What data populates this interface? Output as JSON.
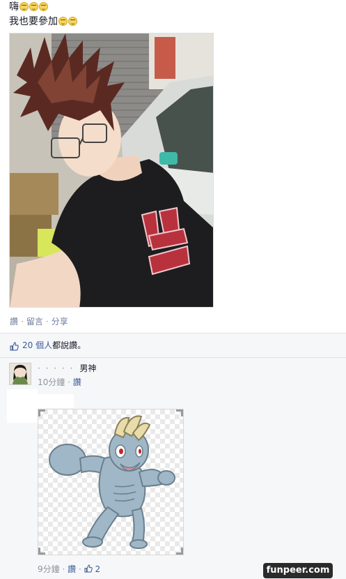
{
  "post": {
    "line1": "嗨",
    "line2": "我也要參加",
    "line1_emoji_count": 3,
    "line2_emoji_count": 2
  },
  "actions": {
    "like": "讚",
    "comment": "留言",
    "share": "分享",
    "separator": "·"
  },
  "likes": {
    "count_text": "20 個人",
    "suffix": "都說讚。"
  },
  "comment": {
    "author_obscured": "· · · · ·",
    "text": "男神",
    "time": "10分鐘",
    "like_label": "讚",
    "separator": "·"
  },
  "comment_footer": {
    "time": "9分鐘",
    "like_label": "讚",
    "like_count": "2",
    "separator": "·"
  },
  "watermark": {
    "text": "funpeer.com"
  },
  "colors": {
    "link": "#3b5998",
    "meta": "#90949c",
    "feedback_bg": "#f6f7f9"
  }
}
